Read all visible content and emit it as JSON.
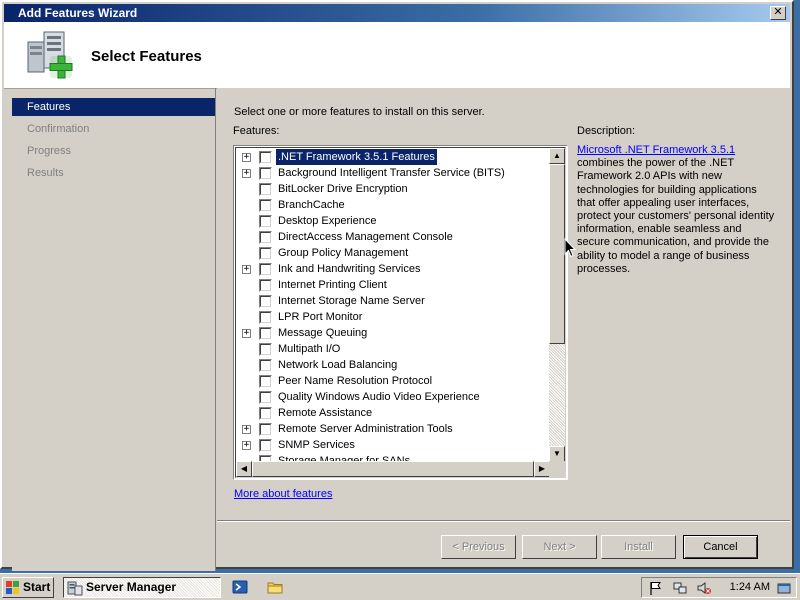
{
  "window": {
    "title": "Add Features Wizard",
    "close_label": "✕"
  },
  "header": {
    "title": "Select Features",
    "icon": "server-add-icon"
  },
  "sidebar": {
    "items": [
      {
        "label": "Features",
        "active": true
      },
      {
        "label": "Confirmation",
        "active": false
      },
      {
        "label": "Progress",
        "active": false
      },
      {
        "label": "Results",
        "active": false
      }
    ]
  },
  "main": {
    "instruction": "Select one or more features to install on this server.",
    "features_label": "Features:",
    "features": [
      {
        "label": ".NET Framework 3.5.1 Features",
        "expandable": true,
        "checked": false,
        "selected": true
      },
      {
        "label": "Background Intelligent Transfer Service (BITS)",
        "expandable": true,
        "checked": false
      },
      {
        "label": "BitLocker Drive Encryption",
        "expandable": false,
        "checked": false
      },
      {
        "label": "BranchCache",
        "expandable": false,
        "checked": false
      },
      {
        "label": "Desktop Experience",
        "expandable": false,
        "checked": false
      },
      {
        "label": "DirectAccess Management Console",
        "expandable": false,
        "checked": false
      },
      {
        "label": "Group Policy Management",
        "expandable": false,
        "checked": false
      },
      {
        "label": "Ink and Handwriting Services",
        "expandable": true,
        "checked": false
      },
      {
        "label": "Internet Printing Client",
        "expandable": false,
        "checked": false
      },
      {
        "label": "Internet Storage Name Server",
        "expandable": false,
        "checked": false
      },
      {
        "label": "LPR Port Monitor",
        "expandable": false,
        "checked": false
      },
      {
        "label": "Message Queuing",
        "expandable": true,
        "checked": false
      },
      {
        "label": "Multipath I/O",
        "expandable": false,
        "checked": false
      },
      {
        "label": "Network Load Balancing",
        "expandable": false,
        "checked": false
      },
      {
        "label": "Peer Name Resolution Protocol",
        "expandable": false,
        "checked": false
      },
      {
        "label": "Quality Windows Audio Video Experience",
        "expandable": false,
        "checked": false
      },
      {
        "label": "Remote Assistance",
        "expandable": false,
        "checked": false
      },
      {
        "label": "Remote Server Administration Tools",
        "expandable": true,
        "checked": false
      },
      {
        "label": "SNMP Services",
        "expandable": true,
        "checked": false
      },
      {
        "label": "Storage Manager for SANs",
        "expandable": false,
        "checked": false
      }
    ],
    "description_label": "Description:",
    "description_link": "Microsoft .NET Framework 3.5.1",
    "description_text": "combines the power of the .NET Framework 2.0 APIs with new technologies for building applications that offer appealing user interfaces, protect your customers' personal identity information, enable seamless and secure communication, and provide the ability to model a range of business processes.",
    "more_link": "More about features"
  },
  "buttons": {
    "previous": "< Previous",
    "next": "Next >",
    "install": "Install",
    "cancel": "Cancel"
  },
  "taskbar": {
    "start_label": "Start",
    "task_item": "Server Manager",
    "clock": "1:24 AM"
  }
}
